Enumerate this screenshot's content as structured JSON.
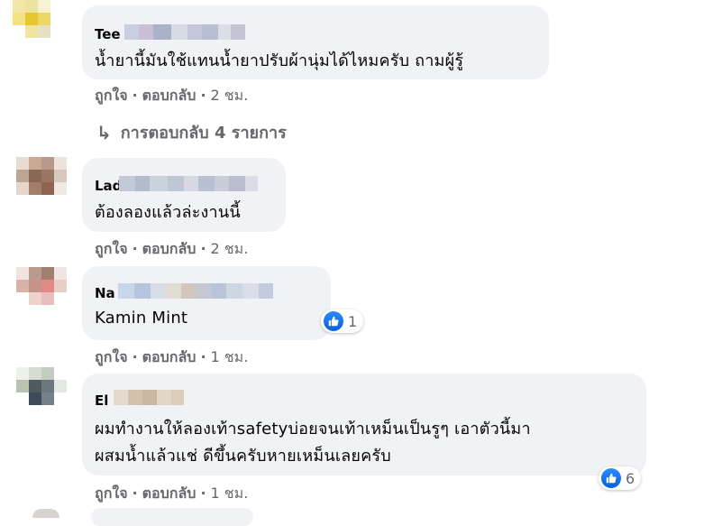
{
  "comments": [
    {
      "author": "Tee",
      "text_lines": [
        "น้ำยานี้มันใช้แทนน้ำยาปรับผ้านุ่มได้ไหมครับ ถามผู้รู้"
      ],
      "like_label": "ถูกใจ",
      "reply_label": "ตอบกลับ",
      "time": "2 ชม.",
      "replies_label": "การตอบกลับ 4 รายการ"
    },
    {
      "author": "Ladaa",
      "text_lines": [
        "ต้องลองแล้วล่ะงานนี้"
      ],
      "like_label": "ถูกใจ",
      "reply_label": "ตอบกลับ",
      "time": "2 ชม."
    },
    {
      "author": "Na",
      "text_lines": [
        "Kamin Mint"
      ],
      "like_label": "ถูกใจ",
      "reply_label": "ตอบกลับ",
      "time": "1 ชม.",
      "reaction_count": "1"
    },
    {
      "author": "El",
      "text_lines": [
        "ผมทำงานให้ลองเท้าsafetyบ่อยจนเท้าเหม็นเป็นรูๆ เอาตัวนี้มา",
        "ผสมน้ำแล้วแช่ ดีขึ้นครับหายเหม็นเลยครับ"
      ],
      "like_label": "ถูกใจ",
      "reply_label": "ตอบกลับ",
      "time": "1 ชม.",
      "reaction_count": "6"
    }
  ],
  "separator": "·",
  "colors": {
    "bubble": "#f0f2f5",
    "secondary_text": "#65676b",
    "like_blue": "#1877f2"
  }
}
